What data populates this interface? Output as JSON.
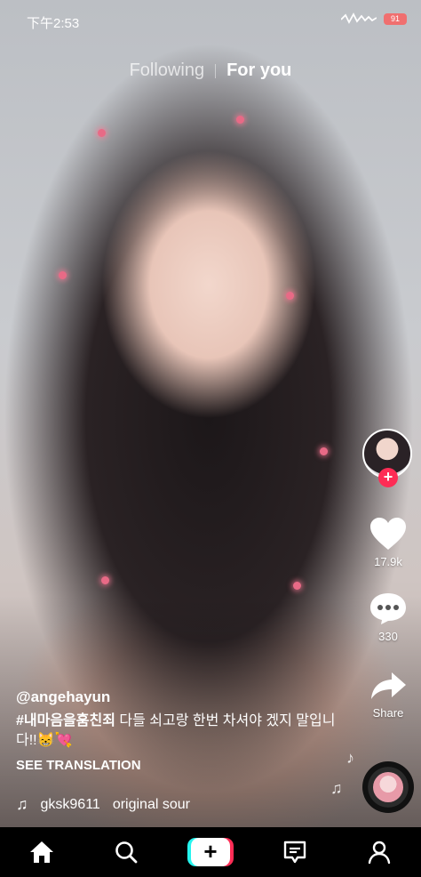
{
  "status_bar": {
    "time": "下午2:53",
    "battery": "91"
  },
  "top_tabs": {
    "following": "Following",
    "for_you": "For you"
  },
  "rail": {
    "likes": "17.9k",
    "comments": "330",
    "share": "Share"
  },
  "caption": {
    "username": "@angehayun",
    "hashtag": "#내마음을훔친죄",
    "text": " 다들 쇠고랑 한번 차셔야 겠지 말입니다!!😸💘",
    "see_translation": "SEE TRANSLATION"
  },
  "music": {
    "author": "gksk9611",
    "title": "original sour"
  },
  "bottom_nav": {
    "create": "+"
  },
  "colors": {
    "accent_red": "#fe2c55",
    "accent_cyan": "#25f4ee",
    "nav_bg": "#000000"
  },
  "icons": [
    "home-icon",
    "search-icon",
    "create-icon",
    "inbox-icon",
    "profile-icon",
    "heart-icon",
    "comment-icon",
    "share-icon",
    "music-note-icon"
  ]
}
